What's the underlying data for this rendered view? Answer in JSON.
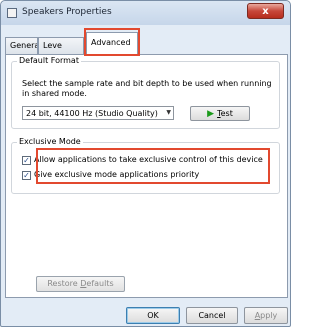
{
  "window": {
    "title": "Speakers Properties",
    "close_glyph": "x"
  },
  "tabs": [
    {
      "label": "General"
    },
    {
      "label": "Leve"
    },
    {
      "label": "Advanced"
    }
  ],
  "default_format": {
    "group_label": "Default Format",
    "description": "Select the sample rate and bit depth to be used when running in shared mode.",
    "selected_format": "24 bit, 44100 Hz (Studio Quality)",
    "test_label_underlined": "T",
    "test_label_rest": "est"
  },
  "exclusive_mode": {
    "group_label": "Exclusive Mode",
    "options": [
      {
        "label": "Allow applications to take exclusive control of this device",
        "checked": true
      },
      {
        "label": "Give exclusive mode applications priority",
        "checked": true
      }
    ]
  },
  "restore": {
    "prefix": "Restore ",
    "underlined": "D",
    "suffix": "efaults"
  },
  "buttons": {
    "ok": "OK",
    "cancel": "Cancel",
    "apply_underlined": "A",
    "apply_rest": "pply"
  },
  "colors": {
    "highlight": "#e2492f",
    "accent": "#3c7fb1",
    "play": "#1b9a1b"
  },
  "icons": {
    "window": "speaker-icon",
    "dropdown": "chevron-down-icon",
    "test": "play-icon",
    "close": "close-icon"
  }
}
